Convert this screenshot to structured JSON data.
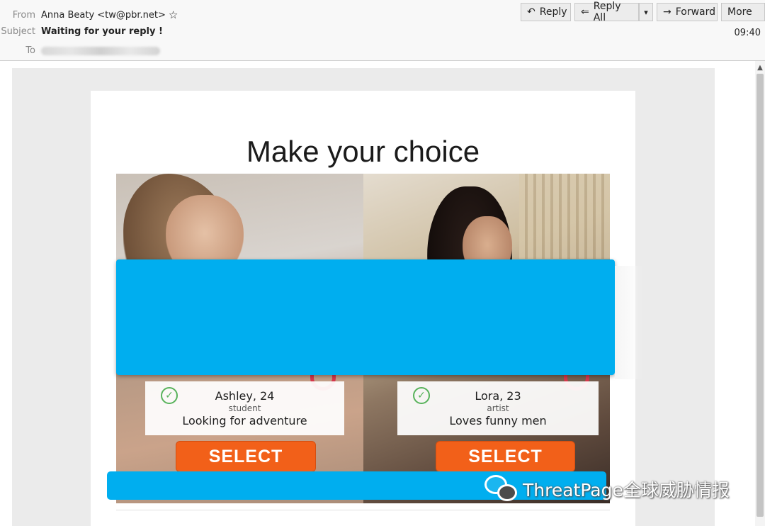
{
  "header": {
    "from_label": "From",
    "from_value": "Anna Beaty <tw@pbr.net>",
    "subject_label": "Subject",
    "subject_value": "Waiting for your reply !",
    "to_label": "To",
    "time": "09:40"
  },
  "toolbar": {
    "reply": "Reply",
    "reply_all": "Reply All",
    "forward": "Forward",
    "more": "More"
  },
  "email": {
    "title": "Make your choice",
    "profiles": [
      {
        "name": "Ashley, 24",
        "role": "student",
        "tagline": "Looking for adventure",
        "button": "SELECT"
      },
      {
        "name": "Lora, 23",
        "role": "artist",
        "tagline": "Loves funny men",
        "button": "SELECT"
      }
    ]
  },
  "watermark": "ThreatPage全球威胁情报",
  "colors": {
    "redaction": "#00aeef",
    "select_button": "#f26019",
    "check": "#57b25a"
  }
}
